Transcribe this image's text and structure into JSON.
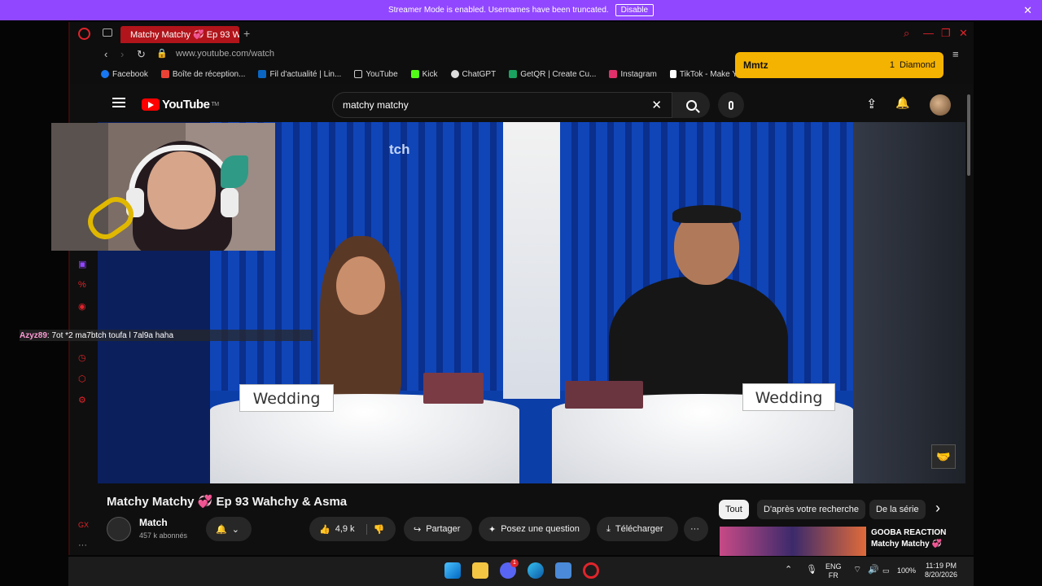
{
  "streamer_bar": {
    "message": "Streamer Mode is enabled. Usernames have been truncated.",
    "disable_label": "Disable",
    "close_icon": "✕"
  },
  "browser": {
    "tab_title": "Matchy Matchy 💞 Ep 93 W",
    "new_tab_icon": "+",
    "url": "www.youtube.com/watch",
    "bookmarks": [
      {
        "label": "Facebook",
        "color": "#1877f2"
      },
      {
        "label": "Boîte de réception...",
        "color": "#ea4335"
      },
      {
        "label": "Fil d'actualité | Lin...",
        "color": "#0a66c2"
      },
      {
        "label": "YouTube",
        "color": "#cccccc"
      },
      {
        "label": "Kick",
        "color": "#53fc18"
      },
      {
        "label": "ChatGPT",
        "color": "#dddddd"
      },
      {
        "label": "GetQR | Create Cu...",
        "color": "#1aa260"
      },
      {
        "label": "Instagram",
        "color": "#e1306c"
      },
      {
        "label": "TikTok - Make You...",
        "color": "#ffffff"
      }
    ]
  },
  "alert": {
    "name": "Mmtz",
    "count": "1",
    "item": "Diamond"
  },
  "youtube": {
    "logo_text": "YouTube",
    "logo_sup": "TM",
    "search_value": "matchy matchy",
    "clear_icon": "✕",
    "upload_icon": "⇪",
    "bell_icon": "🔔"
  },
  "video": {
    "watermark": "tch",
    "sign_left": "Wedding",
    "sign_right": "Wedding",
    "corner_icon": "🤝"
  },
  "chat": {
    "user": "Azyz89",
    "message": ": 7ot *2 ma7btch toufa l 7al9a haha"
  },
  "below": {
    "title": "Matchy Matchy 💞 Ep 93 Wahchy & Asma",
    "channel": "Match",
    "subscribers": "457 k abonnés",
    "likes": "4,9 k",
    "share": "Partager",
    "ask": "Posez une question",
    "download": "Télécharger",
    "more": "···"
  },
  "chips": {
    "all": "Tout",
    "search": "D'après votre recherche",
    "series": "De la série",
    "next": "›"
  },
  "recommendation": {
    "line1": "GOOBA REACTION",
    "line2": "Matchy Matchy 💞"
  },
  "taskbar": {
    "lang_top": "ENG",
    "lang_bottom": "FR",
    "battery": "100%",
    "time": "11:19 PM",
    "date": "8/20/2026",
    "discord_badge": "1"
  }
}
